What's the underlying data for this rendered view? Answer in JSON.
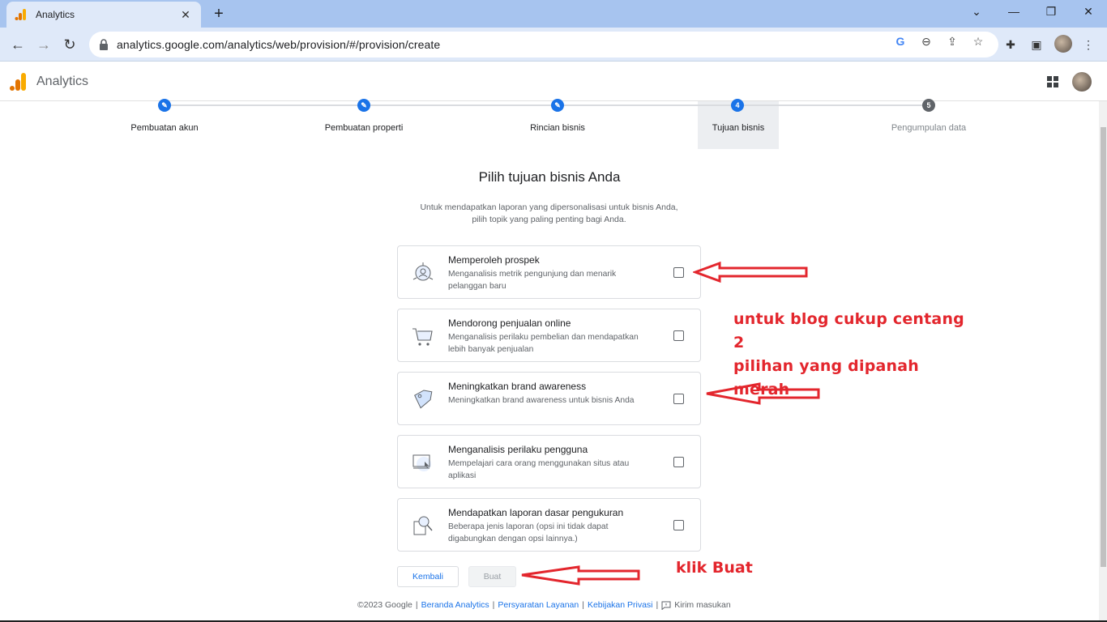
{
  "browser": {
    "tab_title": "Analytics",
    "url": "analytics.google.com/analytics/web/provision/#/provision/create"
  },
  "app": {
    "title": "Analytics"
  },
  "stepper": {
    "steps": [
      {
        "label": "Pembuatan akun",
        "state": "done"
      },
      {
        "label": "Pembuatan properti",
        "state": "done"
      },
      {
        "label": "Rincian bisnis",
        "state": "done"
      },
      {
        "label": "Tujuan bisnis",
        "state": "active",
        "number": "4"
      },
      {
        "label": "Pengumpulan data",
        "state": "pending",
        "number": "5"
      }
    ]
  },
  "main": {
    "heading": "Pilih tujuan bisnis Anda",
    "subtext_line1": "Untuk mendapatkan laporan yang dipersonalisasi untuk bisnis Anda,",
    "subtext_line2": "pilih topik yang paling penting bagi Anda.",
    "options": [
      {
        "title": "Memperoleh prospek",
        "desc": "Menganalisis metrik pengunjung dan menarik pelanggan baru",
        "icon": "target-person-icon",
        "checked": false
      },
      {
        "title": "Mendorong penjualan online",
        "desc": "Menganalisis perilaku pembelian dan mendapatkan lebih banyak penjualan",
        "icon": "shopping-cart-icon",
        "checked": false
      },
      {
        "title": "Meningkatkan brand awareness",
        "desc": "Meningkatkan brand awareness untuk bisnis Anda",
        "icon": "tag-icon",
        "checked": false
      },
      {
        "title": "Menganalisis perilaku pengguna",
        "desc": "Mempelajari cara orang menggunakan situs atau aplikasi",
        "icon": "screen-cursor-icon",
        "checked": false
      },
      {
        "title": "Mendapatkan laporan dasar pengukuran",
        "desc": "Beberapa jenis laporan (opsi ini tidak dapat digabungkan dengan opsi lainnya.)",
        "icon": "magnifier-report-icon",
        "checked": false
      }
    ],
    "back_label": "Kembali",
    "create_label": "Buat"
  },
  "footer": {
    "copyright": "©2023 Google",
    "link_home": "Beranda Analytics",
    "link_terms": "Persyaratan Layanan",
    "link_privacy": "Kebijakan Privasi",
    "feedback": "Kirim masukan"
  },
  "annotations": {
    "note_line1": "untuk blog cukup centang 2",
    "note_line2": "pilihan yang dipanah merah",
    "note_create": "klik Buat",
    "color": "#e3262d"
  },
  "colors": {
    "accent": "#1a73e8",
    "tabbar": "#a7c4ef",
    "toolbar": "#dfe9f9"
  }
}
